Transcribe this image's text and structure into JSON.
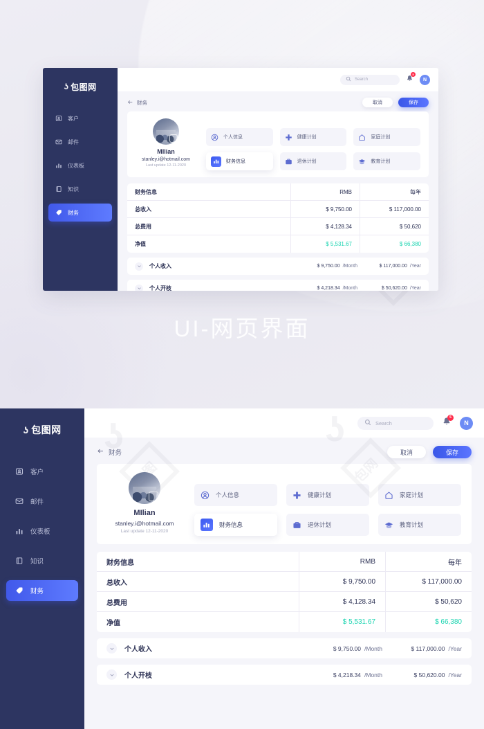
{
  "preview": {
    "title": "UI-网页界面",
    "watermark": "包图网"
  },
  "sidebar": {
    "logo_mark": "ʖ",
    "logo_text": "包图网",
    "items": [
      {
        "label": "客户",
        "icon": "contact-card-icon",
        "active": false
      },
      {
        "label": "邮件",
        "icon": "mail-icon",
        "active": false
      },
      {
        "label": "仪表板",
        "icon": "bar-chart-icon",
        "active": false
      },
      {
        "label": "知识",
        "icon": "book-icon",
        "active": false
      },
      {
        "label": "财务",
        "icon": "tag-icon",
        "active": true
      }
    ]
  },
  "topbar": {
    "search_placeholder": "Search",
    "search_value": "",
    "search_icon": "search-icon",
    "bell_icon": "bell-icon",
    "badge_count": "5",
    "avatar_initial": "N"
  },
  "header": {
    "back_icon": "arrow-left-icon",
    "breadcrumb": "财务",
    "cancel_label": "取消",
    "save_label": "保存"
  },
  "profile": {
    "name": "MIlian",
    "email": "stanley.i@hotmail.com",
    "last_update": "Last update 12-11-2020"
  },
  "options": [
    {
      "label": "个人信息",
      "icon": "user-circle-icon",
      "active": false
    },
    {
      "label": "健康计划",
      "icon": "medical-cross-icon",
      "active": false
    },
    {
      "label": "家庭计划",
      "icon": "home-icon",
      "active": false
    },
    {
      "label": "财务信息",
      "icon": "bar-chart-icon",
      "active": true
    },
    {
      "label": "退休计划",
      "icon": "briefcase-icon",
      "active": false
    },
    {
      "label": "教育计划",
      "icon": "graduation-cap-icon",
      "active": false
    }
  ],
  "table": {
    "headers": [
      "财务信息",
      "RMB",
      "每年"
    ],
    "rows": [
      {
        "label": "总收入",
        "rmb": "$ 9,750.00",
        "year": "$ 117,000.00",
        "highlight": false
      },
      {
        "label": "总费用",
        "rmb": "$ 4,128.34",
        "year": "$ 50,620",
        "highlight": false
      },
      {
        "label": "净值",
        "rmb": "$ 5,531.67",
        "year": "$ 66,380",
        "highlight": true
      }
    ]
  },
  "expandables": [
    {
      "label": "个人收入",
      "chevron": "chevron-down-icon",
      "month_value": "$ 9,750.00",
      "month_unit": "/Month",
      "year_value": "$ 117,000.00",
      "year_unit": "/Year"
    },
    {
      "label": "个人开枝",
      "chevron": "chevron-down-icon",
      "month_value": "$ 4,218.34",
      "month_unit": "/Month",
      "year_value": "$ 50,620.00",
      "year_unit": "/Year"
    }
  ],
  "colors": {
    "sidebar_bg": "#2d3561",
    "accent": "#3a57e8",
    "positive": "#19d4b0",
    "badge": "#ff2d4b"
  }
}
